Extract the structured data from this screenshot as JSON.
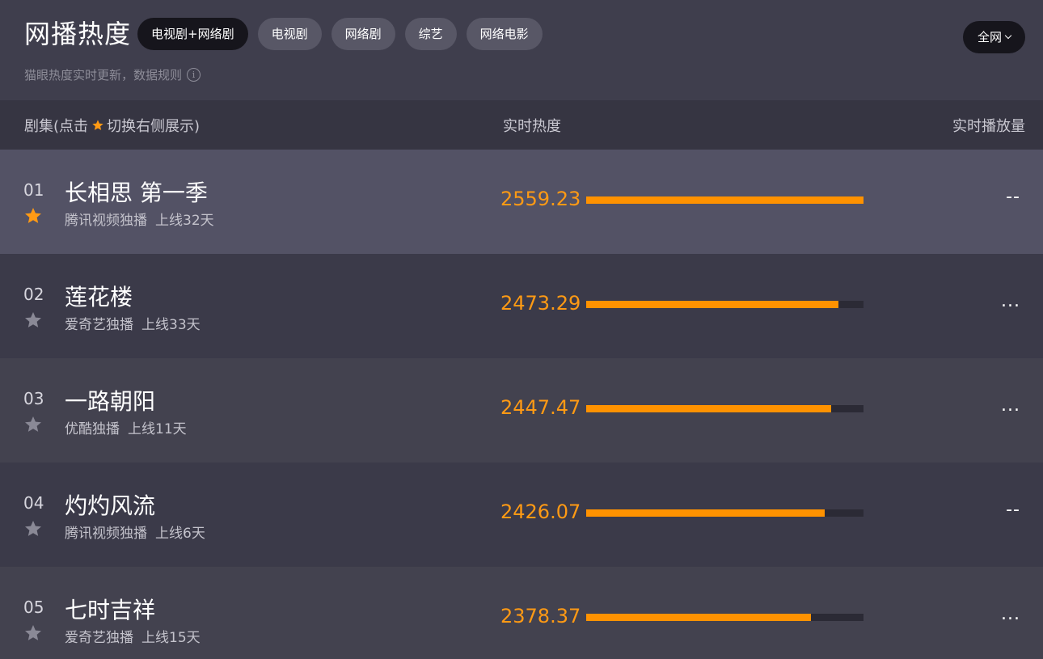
{
  "header": {
    "title": "网播热度",
    "subtitle": "猫眼热度实时更新，数据规则",
    "info_icon": "i",
    "region": "全网",
    "tabs": [
      {
        "label": "电视剧+网络剧",
        "active": true
      },
      {
        "label": "电视剧",
        "active": false
      },
      {
        "label": "网络剧",
        "active": false
      },
      {
        "label": "综艺",
        "active": false
      },
      {
        "label": "网络电影",
        "active": false
      }
    ]
  },
  "columns": {
    "series_prefix": "剧集(点击",
    "series_suffix": "切换右侧展示)",
    "heat": "实时热度",
    "plays": "实时播放量"
  },
  "colors": {
    "accent": "#ff9a14",
    "star_active": "#ff9a14",
    "star_inactive": "#8a8996"
  },
  "rows": [
    {
      "rank": "01",
      "name": "长相思 第一季",
      "platform": "腾讯视频独播",
      "days": "上线32天",
      "heat": "2559.23",
      "heat_value": 2559.23,
      "plays": "--",
      "starred": true
    },
    {
      "rank": "02",
      "name": "莲花楼",
      "platform": "爱奇艺独播",
      "days": "上线33天",
      "heat": "2473.29",
      "heat_value": 2473.29,
      "plays": "...",
      "starred": false
    },
    {
      "rank": "03",
      "name": "一路朝阳",
      "platform": "优酷独播",
      "days": "上线11天",
      "heat": "2447.47",
      "heat_value": 2447.47,
      "plays": "...",
      "starred": false
    },
    {
      "rank": "04",
      "name": "灼灼风流",
      "platform": "腾讯视频独播",
      "days": "上线6天",
      "heat": "2426.07",
      "heat_value": 2426.07,
      "plays": "--",
      "starred": false
    },
    {
      "rank": "05",
      "name": "七时吉祥",
      "platform": "爱奇艺独播",
      "days": "上线15天",
      "heat": "2378.37",
      "heat_value": 2378.37,
      "plays": "...",
      "starred": false
    }
  ]
}
